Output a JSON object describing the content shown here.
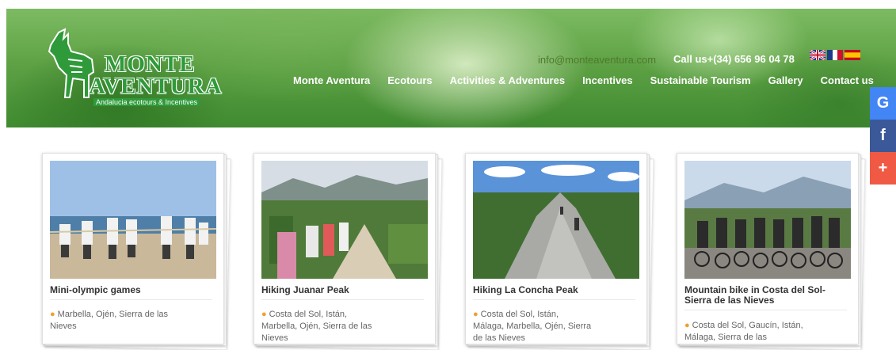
{
  "brand": {
    "name_line1": "MONTE",
    "name_line2": "AVENTURA",
    "tagline": "Andalucia ecotours & Incentives"
  },
  "contact": {
    "email": "info@monteaventura.com",
    "phone": "Call us+(34) 656 96 04 78"
  },
  "languages": [
    "English",
    "French",
    "Spanish"
  ],
  "nav": [
    "Monte Aventura",
    "Ecotours",
    "Activities & Adventures",
    "Incentives",
    "Sustainable Tourism",
    "Gallery",
    "Contact us"
  ],
  "social": [
    {
      "glyph": "G",
      "icon": "google-icon",
      "color": "#4285f4"
    },
    {
      "glyph": "f",
      "icon": "facebook-icon",
      "color": "#3b5998"
    },
    {
      "glyph": "+",
      "icon": "share-plus-icon",
      "color": "#f05a44"
    }
  ],
  "cards": [
    {
      "title": "Mini-olympic games",
      "location": "Marbella, Ojén, Sierra de las Nieves"
    },
    {
      "title": "Hiking Juanar Peak",
      "location": "Costa del Sol, Istán, Marbella, Ojén, Sierra de las Nieves"
    },
    {
      "title": "Hiking La Concha Peak",
      "location": "Costa del Sol, Istán, Málaga, Marbella, Ojén, Sierra de las Nieves"
    },
    {
      "title": "Mountain bike in Costa del Sol-Sierra de las Nieves",
      "location": "Costa del Sol, Gaucín, Istán, Málaga, Sierra de las"
    }
  ],
  "colors": {
    "brand_green": "#2f9a3a",
    "pin_orange": "#f0a030"
  }
}
